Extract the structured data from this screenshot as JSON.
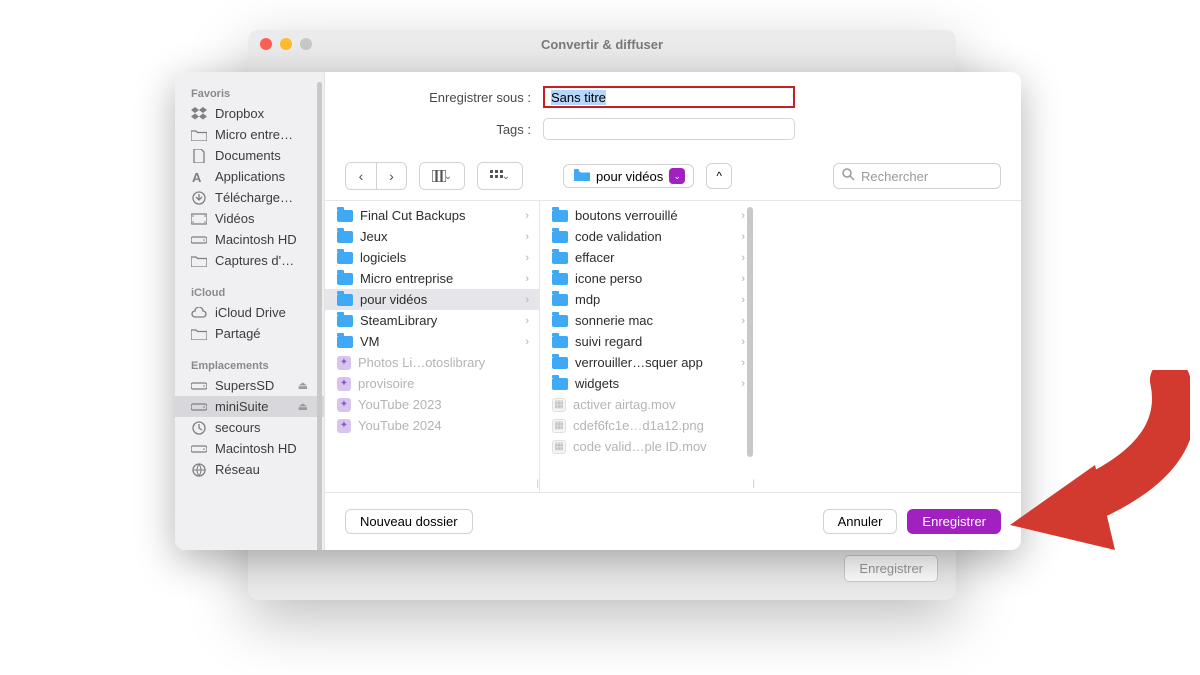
{
  "back_window": {
    "title": "Convertir & diffuser",
    "register_btn": "Enregistrer"
  },
  "form": {
    "save_as_label": "Enregistrer sous :",
    "filename": "Sans titre",
    "tags_label": "Tags :"
  },
  "path_popup": {
    "folder": "pour vidéos"
  },
  "search": {
    "placeholder": "Rechercher"
  },
  "sidebar": {
    "favorites_title": "Favoris",
    "favorites": [
      {
        "icon": "dropbox",
        "label": "Dropbox"
      },
      {
        "icon": "folder",
        "label": "Micro entre…"
      },
      {
        "icon": "doc",
        "label": "Documents"
      },
      {
        "icon": "apps",
        "label": "Applications"
      },
      {
        "icon": "download",
        "label": "Télécharge…"
      },
      {
        "icon": "video",
        "label": "Vidéos"
      },
      {
        "icon": "disk",
        "label": "Macintosh HD"
      },
      {
        "icon": "folder",
        "label": "Captures d'…"
      }
    ],
    "icloud_title": "iCloud",
    "icloud": [
      {
        "icon": "cloud",
        "label": "iCloud Drive"
      },
      {
        "icon": "shared",
        "label": "Partagé"
      }
    ],
    "locations_title": "Emplacements",
    "locations": [
      {
        "icon": "drive",
        "label": "SupersSD",
        "eject": true
      },
      {
        "icon": "drive",
        "label": "miniSuite",
        "eject": true,
        "selected": true
      },
      {
        "icon": "time",
        "label": "secours"
      },
      {
        "icon": "drive",
        "label": "Macintosh HD"
      },
      {
        "icon": "network",
        "label": "Réseau"
      }
    ]
  },
  "column1": [
    {
      "type": "folder",
      "name": "Final Cut Backups",
      "chev": true
    },
    {
      "type": "folder",
      "name": "Jeux",
      "chev": true
    },
    {
      "type": "folder",
      "name": "logiciels",
      "chev": true
    },
    {
      "type": "folder",
      "name": "Micro entreprise",
      "chev": true
    },
    {
      "type": "folder",
      "name": "pour vidéos",
      "chev": true,
      "selected": true
    },
    {
      "type": "folder",
      "name": "SteamLibrary",
      "chev": true
    },
    {
      "type": "folder",
      "name": "VM",
      "chev": true
    },
    {
      "type": "lib-purple",
      "name": "Photos Li…otoslibrary",
      "chev": false,
      "dim": true
    },
    {
      "type": "lib-purple",
      "name": "provisoire",
      "chev": false,
      "dim": true
    },
    {
      "type": "lib-purple",
      "name": "YouTube 2023",
      "chev": false,
      "dim": true
    },
    {
      "type": "lib-purple",
      "name": "YouTube 2024",
      "chev": false,
      "dim": true
    }
  ],
  "column2": [
    {
      "type": "folder",
      "name": "boutons verrouillé",
      "chev": true
    },
    {
      "type": "folder",
      "name": "code validation",
      "chev": true
    },
    {
      "type": "folder",
      "name": "effacer",
      "chev": true
    },
    {
      "type": "folder",
      "name": "icone perso",
      "chev": true
    },
    {
      "type": "folder",
      "name": "mdp",
      "chev": true
    },
    {
      "type": "folder",
      "name": "sonnerie mac",
      "chev": true
    },
    {
      "type": "folder",
      "name": "suivi regard",
      "chev": true
    },
    {
      "type": "folder",
      "name": "verrouiller…squer app",
      "chev": true
    },
    {
      "type": "folder",
      "name": "widgets",
      "chev": true
    },
    {
      "type": "file",
      "name": "activer airtag.mov",
      "chev": false,
      "dim": true
    },
    {
      "type": "file",
      "name": "cdef6fc1e…d1a12.png",
      "chev": false,
      "dim": true
    },
    {
      "type": "file",
      "name": "code valid…ple ID.mov",
      "chev": false,
      "dim": true
    }
  ],
  "footer": {
    "new_folder": "Nouveau dossier",
    "cancel": "Annuler",
    "save": "Enregistrer"
  }
}
